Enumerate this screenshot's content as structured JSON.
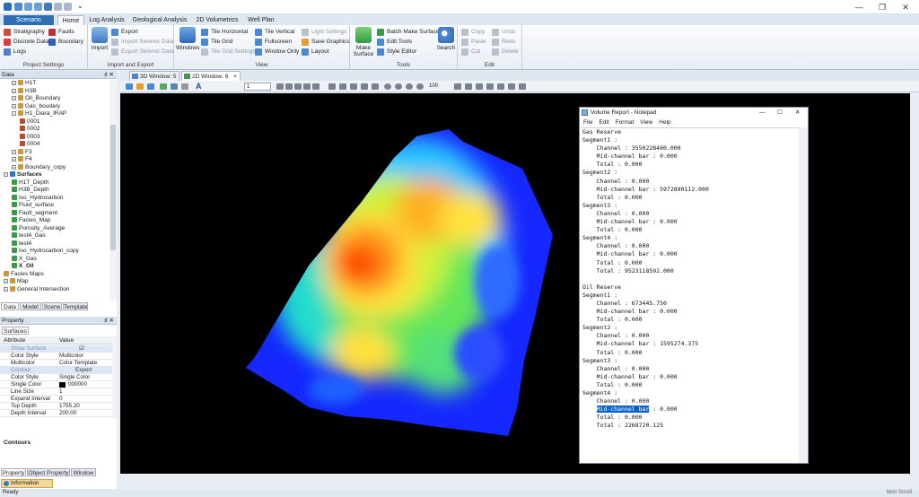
{
  "window": {
    "title_chevron": "⌄",
    "minimize": "—",
    "maximize": "❐",
    "close": "✕"
  },
  "ribbon_tabs": [
    "Scenario",
    "Home",
    "Log Analysis",
    "Geological Analysis",
    "2D Volumetrics",
    "Well Plan"
  ],
  "ribbon": {
    "project_settings": {
      "label": "Project Settings",
      "items": [
        "Stratigraphy",
        "Faults",
        "Discrete Data",
        "Boundary",
        "Logs"
      ]
    },
    "import_export": {
      "label": "Import and Export",
      "big": "Import",
      "items": [
        "Export",
        "Import Seismic Data",
        "Export Seismic Data"
      ]
    },
    "view": {
      "label": "View",
      "big": "Windows",
      "items": [
        "Tile Horizontal",
        "Tile Grid",
        "Tile Grid Settings",
        "Tile Vertical",
        "Fullscreen",
        "Window Only",
        "Light Settings",
        "Save Graphics",
        "Layout"
      ]
    },
    "tools": {
      "label": "Tools",
      "big1": "Make Surface",
      "items": [
        "Batch Make Surface",
        "Edit Tools",
        "Style Editor"
      ],
      "big2": "Search"
    },
    "edit": {
      "label": "Edit",
      "items": [
        "Copy",
        "Undo",
        "Paste",
        "Redo",
        "Cut",
        "Delete"
      ]
    }
  },
  "data_panel": {
    "title": "Data",
    "pin": "♯ ✕",
    "tree": [
      {
        "label": "H1T",
        "indent": 1,
        "kind": "folder",
        "expand": "+"
      },
      {
        "label": "H3B",
        "indent": 1,
        "kind": "folder",
        "expand": "+"
      },
      {
        "label": "Oil_Boundary",
        "indent": 1,
        "kind": "folder",
        "expand": "+"
      },
      {
        "label": "Gas_boudary",
        "indent": 1,
        "kind": "folder",
        "expand": "+"
      },
      {
        "label": "H1_Diara_IRAP",
        "indent": 1,
        "kind": "folder",
        "expand": "−"
      },
      {
        "label": "0001",
        "indent": 2,
        "kind": "item",
        "expand": ""
      },
      {
        "label": "0002",
        "indent": 2,
        "kind": "item",
        "expand": ""
      },
      {
        "label": "0003",
        "indent": 2,
        "kind": "item",
        "expand": ""
      },
      {
        "label": "0004",
        "indent": 2,
        "kind": "item",
        "expand": ""
      },
      {
        "label": "F3",
        "indent": 1,
        "kind": "folder",
        "expand": "+"
      },
      {
        "label": "F4",
        "indent": 1,
        "kind": "folder",
        "expand": "+"
      },
      {
        "label": "Boundary_copy",
        "indent": 1,
        "kind": "folder",
        "expand": "+"
      },
      {
        "label": "Surfaces",
        "indent": 0,
        "kind": "root",
        "expand": "−"
      },
      {
        "label": "H1T_Depth",
        "indent": 1,
        "kind": "surface",
        "expand": ""
      },
      {
        "label": "H3B_Depth",
        "indent": 1,
        "kind": "surface",
        "expand": ""
      },
      {
        "label": "Iso_Hydrocarbon",
        "indent": 1,
        "kind": "surface",
        "expand": ""
      },
      {
        "label": "Fluid_surface",
        "indent": 1,
        "kind": "surface",
        "expand": ""
      },
      {
        "label": "Fault_segment",
        "indent": 1,
        "kind": "surface",
        "expand": ""
      },
      {
        "label": "Facies_Map",
        "indent": 1,
        "kind": "surface",
        "expand": ""
      },
      {
        "label": "Porosity_Average",
        "indent": 1,
        "kind": "surface",
        "expand": ""
      },
      {
        "label": "test4_Gas",
        "indent": 1,
        "kind": "surface",
        "expand": ""
      },
      {
        "label": "test4",
        "indent": 1,
        "kind": "surface",
        "expand": ""
      },
      {
        "label": "Iso_Hydrocarbon_copy",
        "indent": 1,
        "kind": "surface",
        "expand": ""
      },
      {
        "label": "X_Gas",
        "indent": 1,
        "kind": "surface",
        "expand": ""
      },
      {
        "label": "X_Oil",
        "indent": 1,
        "kind": "surface",
        "expand": ""
      },
      {
        "label": "Facies Maps",
        "indent": 0,
        "kind": "folder",
        "expand": ""
      },
      {
        "label": "Map",
        "indent": 0,
        "kind": "folder",
        "expand": "+"
      },
      {
        "label": "General Intersection",
        "indent": 0,
        "kind": "folder",
        "expand": "+"
      }
    ],
    "tabs": [
      "Data",
      "Model",
      "Scene",
      "Template"
    ]
  },
  "property_panel": {
    "title": "Property",
    "tab": "Surfaces",
    "col_attr": "Attribute",
    "col_val": "Value",
    "rows": [
      {
        "a": "Show Surface",
        "v": "☑",
        "sec": true
      },
      {
        "a": "Color Style",
        "v": "Multicolor",
        "sec": false
      },
      {
        "a": "Multicolor",
        "v": "Color Template",
        "sec": false
      },
      {
        "a": "Contour",
        "v": "Export",
        "sec": true
      },
      {
        "a": "Color Style",
        "v": "Single Color",
        "sec": false
      },
      {
        "a": "Single Color",
        "v": "000000",
        "sec": false
      },
      {
        "a": "Line Size",
        "v": "1",
        "sec": false
      },
      {
        "a": "Expand Interval",
        "v": "0",
        "sec": false
      },
      {
        "a": "Top Depth",
        "v": "1755.20",
        "sec": false
      },
      {
        "a": "Depth Interval",
        "v": "200.00",
        "sec": false
      }
    ],
    "footer": "Contours",
    "bottom_tabs": [
      "Property",
      "Object Property",
      "Window"
    ],
    "info_tab": "Information"
  },
  "view": {
    "tabs": [
      "3D Window: 5",
      "2D Window: 6"
    ],
    "close_glyph": "×",
    "font_letter": "A",
    "zoom_combo": "1",
    "zoom_value": "100"
  },
  "notepad": {
    "title": "Volume Report - Notepad",
    "menu": [
      "File",
      "Edit",
      "Format",
      "View",
      "Help"
    ],
    "lines": [
      "Gas Reserve",
      "Segment1 :",
      "    Channel : 3550228480.000",
      "    Mid-channel bar : 0.000",
      "    Total : 0.000",
      "Segment2 :",
      "    Channel : 0.000",
      "    Mid-channel bar : 5972890112.000",
      "    Total : 0.000",
      "Segment3 :",
      "    Channel : 0.000",
      "    Mid-channel bar : 0.000",
      "    Total : 0.000",
      "Segment4 :",
      "    Channel : 0.000",
      "    Mid-channel bar : 0.000",
      "    Total : 0.000",
      "    Total : 9523118592.000",
      "",
      "Oil Reserve",
      "Segment1 :",
      "    Channel : 673445.750",
      "    Mid-channel bar : 0.000",
      "    Total : 0.000",
      "Segment2 :",
      "    Channel : 0.000",
      "    Mid-channel bar : 1595274.375",
      "    Total : 0.000",
      "Segment3 :",
      "    Channel : 0.000",
      "    Mid-channel bar : 0.000",
      "    Total : 0.000",
      "Segment4 :",
      "    Channel : 0.000",
      "    Mid-channel bar : 0.000",
      "    Total : 0.000",
      "    Total : 2268720.125"
    ],
    "highlight_line": 34,
    "highlight_text": "Mid-channel bar",
    "minimize": "—",
    "maximize": "☐",
    "close": "✕"
  },
  "status": {
    "left": "Ready",
    "right": "Item  Scroll"
  },
  "colors": {
    "accent": "#1e5fa8",
    "map_blue": "#1428ff",
    "map_red": "#ff3a00",
    "selection": "#0a64c8"
  }
}
